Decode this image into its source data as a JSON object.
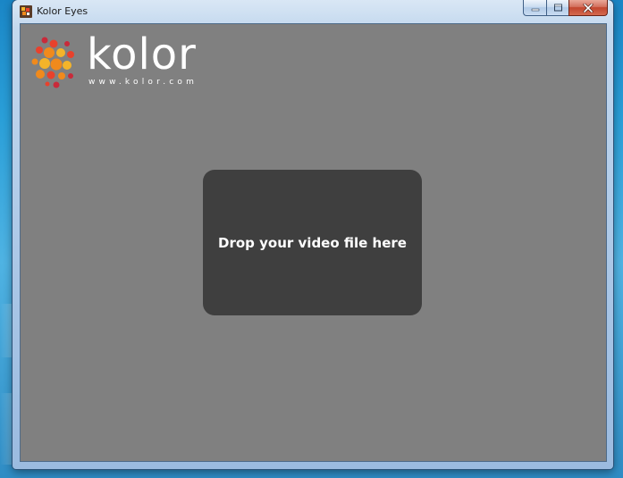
{
  "window": {
    "title": "Kolor Eyes",
    "caption_buttons": {
      "minimize": "minimize-icon",
      "maximize": "maximize-icon",
      "close": "close-icon"
    }
  },
  "logo": {
    "wordmark": "kolor",
    "url": "www.kolor.com",
    "colors": [
      "#e8412c",
      "#f08a1c",
      "#f4b42a",
      "#c92a3a"
    ]
  },
  "drop_zone": {
    "label": "Drop your video file here"
  },
  "colors": {
    "client_background": "#808080",
    "drop_zone_background": "#3f3f3f",
    "titlebar": "#bcd3ec"
  }
}
